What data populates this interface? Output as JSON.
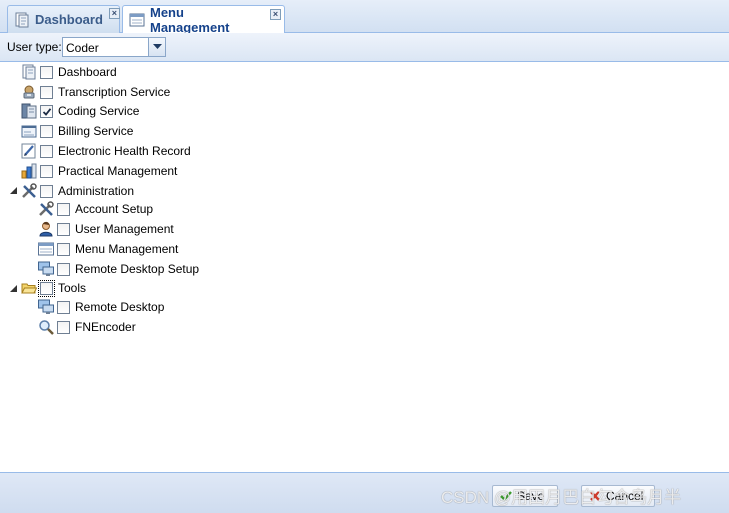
{
  "tabs": [
    {
      "label": "Dashboard",
      "active": false,
      "icon": "dashboard-icon"
    },
    {
      "label": "Menu Management",
      "active": true,
      "icon": "menu-management-icon"
    }
  ],
  "toolbar": {
    "user_type_label": "User type:",
    "user_type_value": "Coder"
  },
  "tree": {
    "items": [
      {
        "label": "Dashboard",
        "icon": "dashboard-icon",
        "checked": false
      },
      {
        "label": "Transcription Service",
        "icon": "transcription-icon",
        "checked": false
      },
      {
        "label": "Coding Service",
        "icon": "coding-icon",
        "checked": true
      },
      {
        "label": "Billing Service",
        "icon": "billing-icon",
        "checked": false
      },
      {
        "label": "Electronic Health Record",
        "icon": "ehr-icon",
        "checked": false
      },
      {
        "label": "Practical Management",
        "icon": "chart-icon",
        "checked": false
      },
      {
        "label": "Administration",
        "icon": "tools-icon",
        "checked": false,
        "expanded": true,
        "children": [
          {
            "label": "Account Setup",
            "icon": "tools-icon",
            "checked": false
          },
          {
            "label": "User Management",
            "icon": "user-icon",
            "checked": false
          },
          {
            "label": "Menu Management",
            "icon": "window-icon",
            "checked": false
          },
          {
            "label": "Remote Desktop Setup",
            "icon": "remote-desktop-icon",
            "checked": false
          }
        ]
      },
      {
        "label": "Tools",
        "icon": "folder-open-icon",
        "checked": false,
        "expanded": true,
        "children": [
          {
            "label": "Remote Desktop",
            "icon": "remote-desktop-icon",
            "checked": false
          },
          {
            "label": "FNEncoder",
            "icon": "magnifier-icon",
            "checked": false
          }
        ]
      }
    ]
  },
  "footer": {
    "save_label": "Save",
    "cancel_label": "Cancel"
  },
  "watermark": "CSDN @用田月巴白勾合鸟月半",
  "colors": {
    "accent": "#15428b",
    "border": "#99bbe8",
    "toolbar_bg": "#dbe6f4"
  }
}
